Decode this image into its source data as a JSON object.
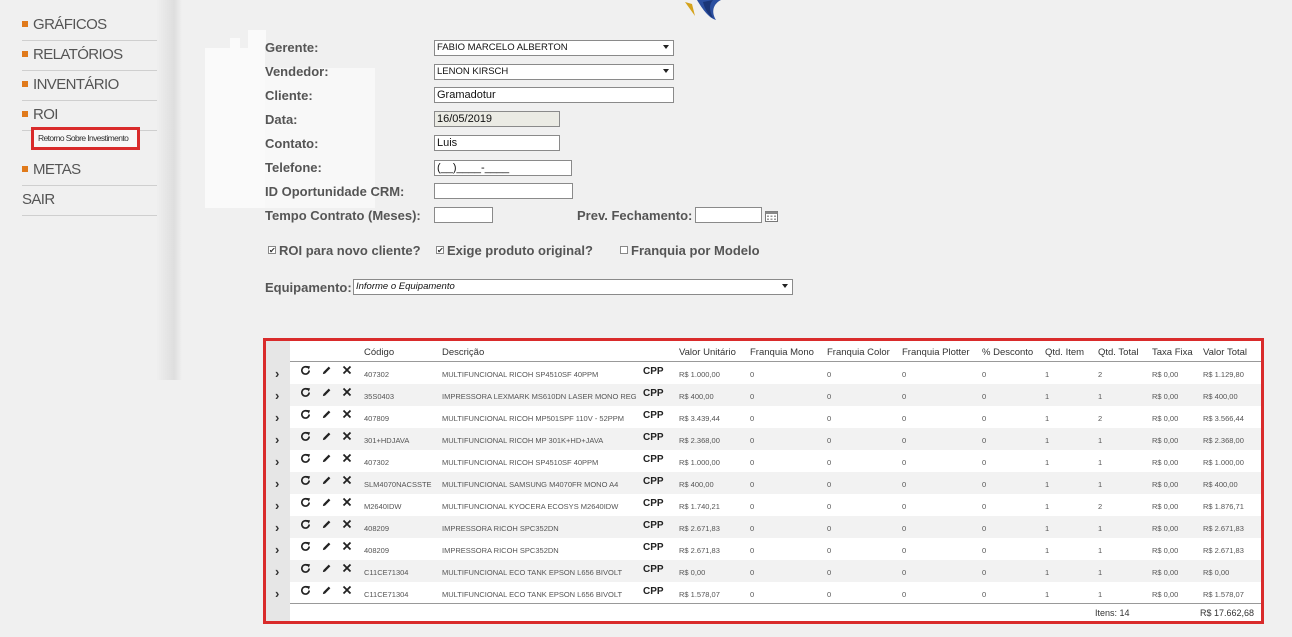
{
  "sidebar": {
    "items": [
      {
        "label": "GRÁFICOS",
        "bullet": true
      },
      {
        "label": "RELATÓRIOS",
        "bullet": true
      },
      {
        "label": "INVENTÁRIO",
        "bullet": true
      },
      {
        "label": "ROI",
        "bullet": true
      },
      {
        "label": "METAS",
        "bullet": true
      },
      {
        "label": "SAIR",
        "bullet": false
      }
    ],
    "submenu_label": "Retorno Sobre Investimento",
    "accent_color": "#e07a1b"
  },
  "form": {
    "gerente_label": "Gerente:",
    "gerente_value": "FABIO MARCELO ALBERTON",
    "vendedor_label": "Vendedor:",
    "vendedor_value": "LENON KIRSCH",
    "cliente_label": "Cliente:",
    "cliente_value": "Gramadotur",
    "data_label": "Data:",
    "data_value": "16/05/2019",
    "contato_label": "Contato:",
    "contato_value": "Luis",
    "telefone_label": "Telefone:",
    "telefone_value": "(__)____-____",
    "crm_label": "ID Oportunidade CRM:",
    "crm_value": "",
    "tempo_label": "Tempo Contrato (Meses):",
    "tempo_value": "",
    "prev_label": "Prev. Fechamento:",
    "prev_value": "",
    "chk_roi_label": "ROI para novo cliente?",
    "chk_roi_checked": true,
    "chk_exige_label": "Exige produto original?",
    "chk_exige_checked": true,
    "chk_franquia_label": "Franquia por Modelo",
    "chk_franquia_checked": false,
    "equip_label": "Equipamento:",
    "equip_placeholder": "Informe o Equipamento"
  },
  "table": {
    "headers": [
      "Código",
      "Descrição",
      "Valor Unitário",
      "Franquia Mono",
      "Franquia Color",
      "Franquia Plotter",
      "% Desconto",
      "Qtd. Item",
      "Qtd. Total",
      "Taxa Fixa",
      "Valor Total"
    ],
    "rows": [
      {
        "codigo": "407302",
        "descricao": "MULTIFUNCIONAL RICOH SP4510SF 40PPM",
        "tipo": "CPP",
        "valor_unit": "R$ 1.000,00",
        "f_mono": "0",
        "f_color": "0",
        "f_plotter": "0",
        "desconto": "0",
        "qtd_item": "1",
        "qtd_total": "2",
        "taxa": "R$ 0,00",
        "total": "R$ 1.129,80"
      },
      {
        "codigo": "35S0403",
        "descricao": "IMPRESSORA LEXMARK MS610DN LASER MONO REG",
        "tipo": "CPP",
        "valor_unit": "R$ 400,00",
        "f_mono": "0",
        "f_color": "0",
        "f_plotter": "0",
        "desconto": "0",
        "qtd_item": "1",
        "qtd_total": "1",
        "taxa": "R$ 0,00",
        "total": "R$ 400,00"
      },
      {
        "codigo": "407809",
        "descricao": "MULTIFUNCIONAL RICOH MP501SPF 110V - 52PPM",
        "tipo": "CPP",
        "valor_unit": "R$ 3.439,44",
        "f_mono": "0",
        "f_color": "0",
        "f_plotter": "0",
        "desconto": "0",
        "qtd_item": "1",
        "qtd_total": "2",
        "taxa": "R$ 0,00",
        "total": "R$ 3.566,44"
      },
      {
        "codigo": "301+HDJAVA",
        "descricao": "MULTIFUNCIONAL RICOH MP 301K+HD+JAVA",
        "tipo": "CPP",
        "valor_unit": "R$ 2.368,00",
        "f_mono": "0",
        "f_color": "0",
        "f_plotter": "0",
        "desconto": "0",
        "qtd_item": "1",
        "qtd_total": "1",
        "taxa": "R$ 0,00",
        "total": "R$ 2.368,00"
      },
      {
        "codigo": "407302",
        "descricao": "MULTIFUNCIONAL RICOH SP4510SF 40PPM",
        "tipo": "CPP",
        "valor_unit": "R$ 1.000,00",
        "f_mono": "0",
        "f_color": "0",
        "f_plotter": "0",
        "desconto": "0",
        "qtd_item": "1",
        "qtd_total": "1",
        "taxa": "R$ 0,00",
        "total": "R$ 1.000,00"
      },
      {
        "codigo": "SLM4070NACSSTE",
        "descricao": "MULTIFUNCIONAL SAMSUNG M4070FR MONO A4",
        "tipo": "CPP",
        "valor_unit": "R$ 400,00",
        "f_mono": "0",
        "f_color": "0",
        "f_plotter": "0",
        "desconto": "0",
        "qtd_item": "1",
        "qtd_total": "1",
        "taxa": "R$ 0,00",
        "total": "R$ 400,00"
      },
      {
        "codigo": "M2640IDW",
        "descricao": "MULTIFUNCIONAL KYOCERA ECOSYS M2640IDW",
        "tipo": "CPP",
        "valor_unit": "R$ 1.740,21",
        "f_mono": "0",
        "f_color": "0",
        "f_plotter": "0",
        "desconto": "0",
        "qtd_item": "1",
        "qtd_total": "2",
        "taxa": "R$ 0,00",
        "total": "R$ 1.876,71"
      },
      {
        "codigo": "408209",
        "descricao": "IMPRESSORA RICOH SPC352DN",
        "tipo": "CPP",
        "valor_unit": "R$ 2.671,83",
        "f_mono": "0",
        "f_color": "0",
        "f_plotter": "0",
        "desconto": "0",
        "qtd_item": "1",
        "qtd_total": "1",
        "taxa": "R$ 0,00",
        "total": "R$ 2.671,83"
      },
      {
        "codigo": "408209",
        "descricao": "IMPRESSORA RICOH SPC352DN",
        "tipo": "CPP",
        "valor_unit": "R$ 2.671,83",
        "f_mono": "0",
        "f_color": "0",
        "f_plotter": "0",
        "desconto": "0",
        "qtd_item": "1",
        "qtd_total": "1",
        "taxa": "R$ 0,00",
        "total": "R$ 2.671,83"
      },
      {
        "codigo": "C11CE71304",
        "descricao": "MULTIFUNCIONAL ECO TANK EPSON L656 BIVOLT",
        "tipo": "CPP",
        "valor_unit": "R$ 0,00",
        "f_mono": "0",
        "f_color": "0",
        "f_plotter": "0",
        "desconto": "0",
        "qtd_item": "1",
        "qtd_total": "1",
        "taxa": "R$ 0,00",
        "total": "R$ 0,00"
      },
      {
        "codigo": "C11CE71304",
        "descricao": "MULTIFUNCIONAL ECO TANK EPSON L656 BIVOLT",
        "tipo": "CPP",
        "valor_unit": "R$ 1.578,07",
        "f_mono": "0",
        "f_color": "0",
        "f_plotter": "0",
        "desconto": "0",
        "qtd_item": "1",
        "qtd_total": "1",
        "taxa": "R$ 0,00",
        "total": "R$ 1.578,07"
      }
    ],
    "footer_items": "Itens: 14",
    "footer_total": "R$ 17.662,68",
    "icons": [
      "expand-icon",
      "refresh-icon",
      "edit-icon",
      "delete-icon"
    ],
    "highlight_color": "#d92b2b"
  }
}
